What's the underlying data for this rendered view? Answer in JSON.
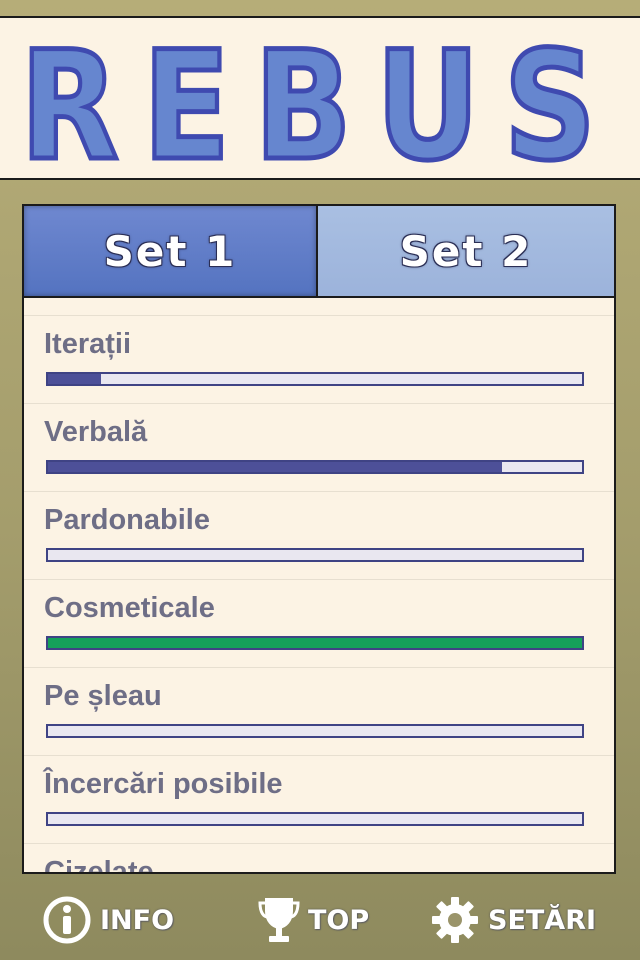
{
  "app": {
    "title": "REBUS"
  },
  "tabs": [
    {
      "label": "Set 1",
      "active": true
    },
    {
      "label": "Set 2",
      "active": false
    }
  ],
  "levels": [
    {
      "label": "Iterații",
      "progress": 0.1,
      "color": "#4d5098"
    },
    {
      "label": "Verbală",
      "progress": 0.85,
      "color": "#4d5098"
    },
    {
      "label": "Pardonabile",
      "progress": 0.0,
      "color": "#4d5098"
    },
    {
      "label": "Cosmeticale",
      "progress": 1.0,
      "color": "#15a15a"
    },
    {
      "label": "Pe șleau",
      "progress": 0.0,
      "color": "#4d5098"
    },
    {
      "label": "Încercări posibile",
      "progress": 0.0,
      "color": "#4d5098"
    },
    {
      "label": "Cizelate",
      "progress": 0.0,
      "color": "#4d5098"
    }
  ],
  "footer": {
    "info": {
      "label": "INFO",
      "icon": "info-icon"
    },
    "top": {
      "label": "TOP",
      "icon": "trophy-icon"
    },
    "settings": {
      "label": "SETĂRI",
      "icon": "gear-icon"
    }
  },
  "colors": {
    "title_fill": "#6686cf",
    "title_stroke": "#3f4ab0",
    "accent_tab": "#5d7bc7",
    "inactive_tab": "#a3b9df",
    "progress_blue": "#4d5098",
    "progress_green": "#15a15a"
  }
}
